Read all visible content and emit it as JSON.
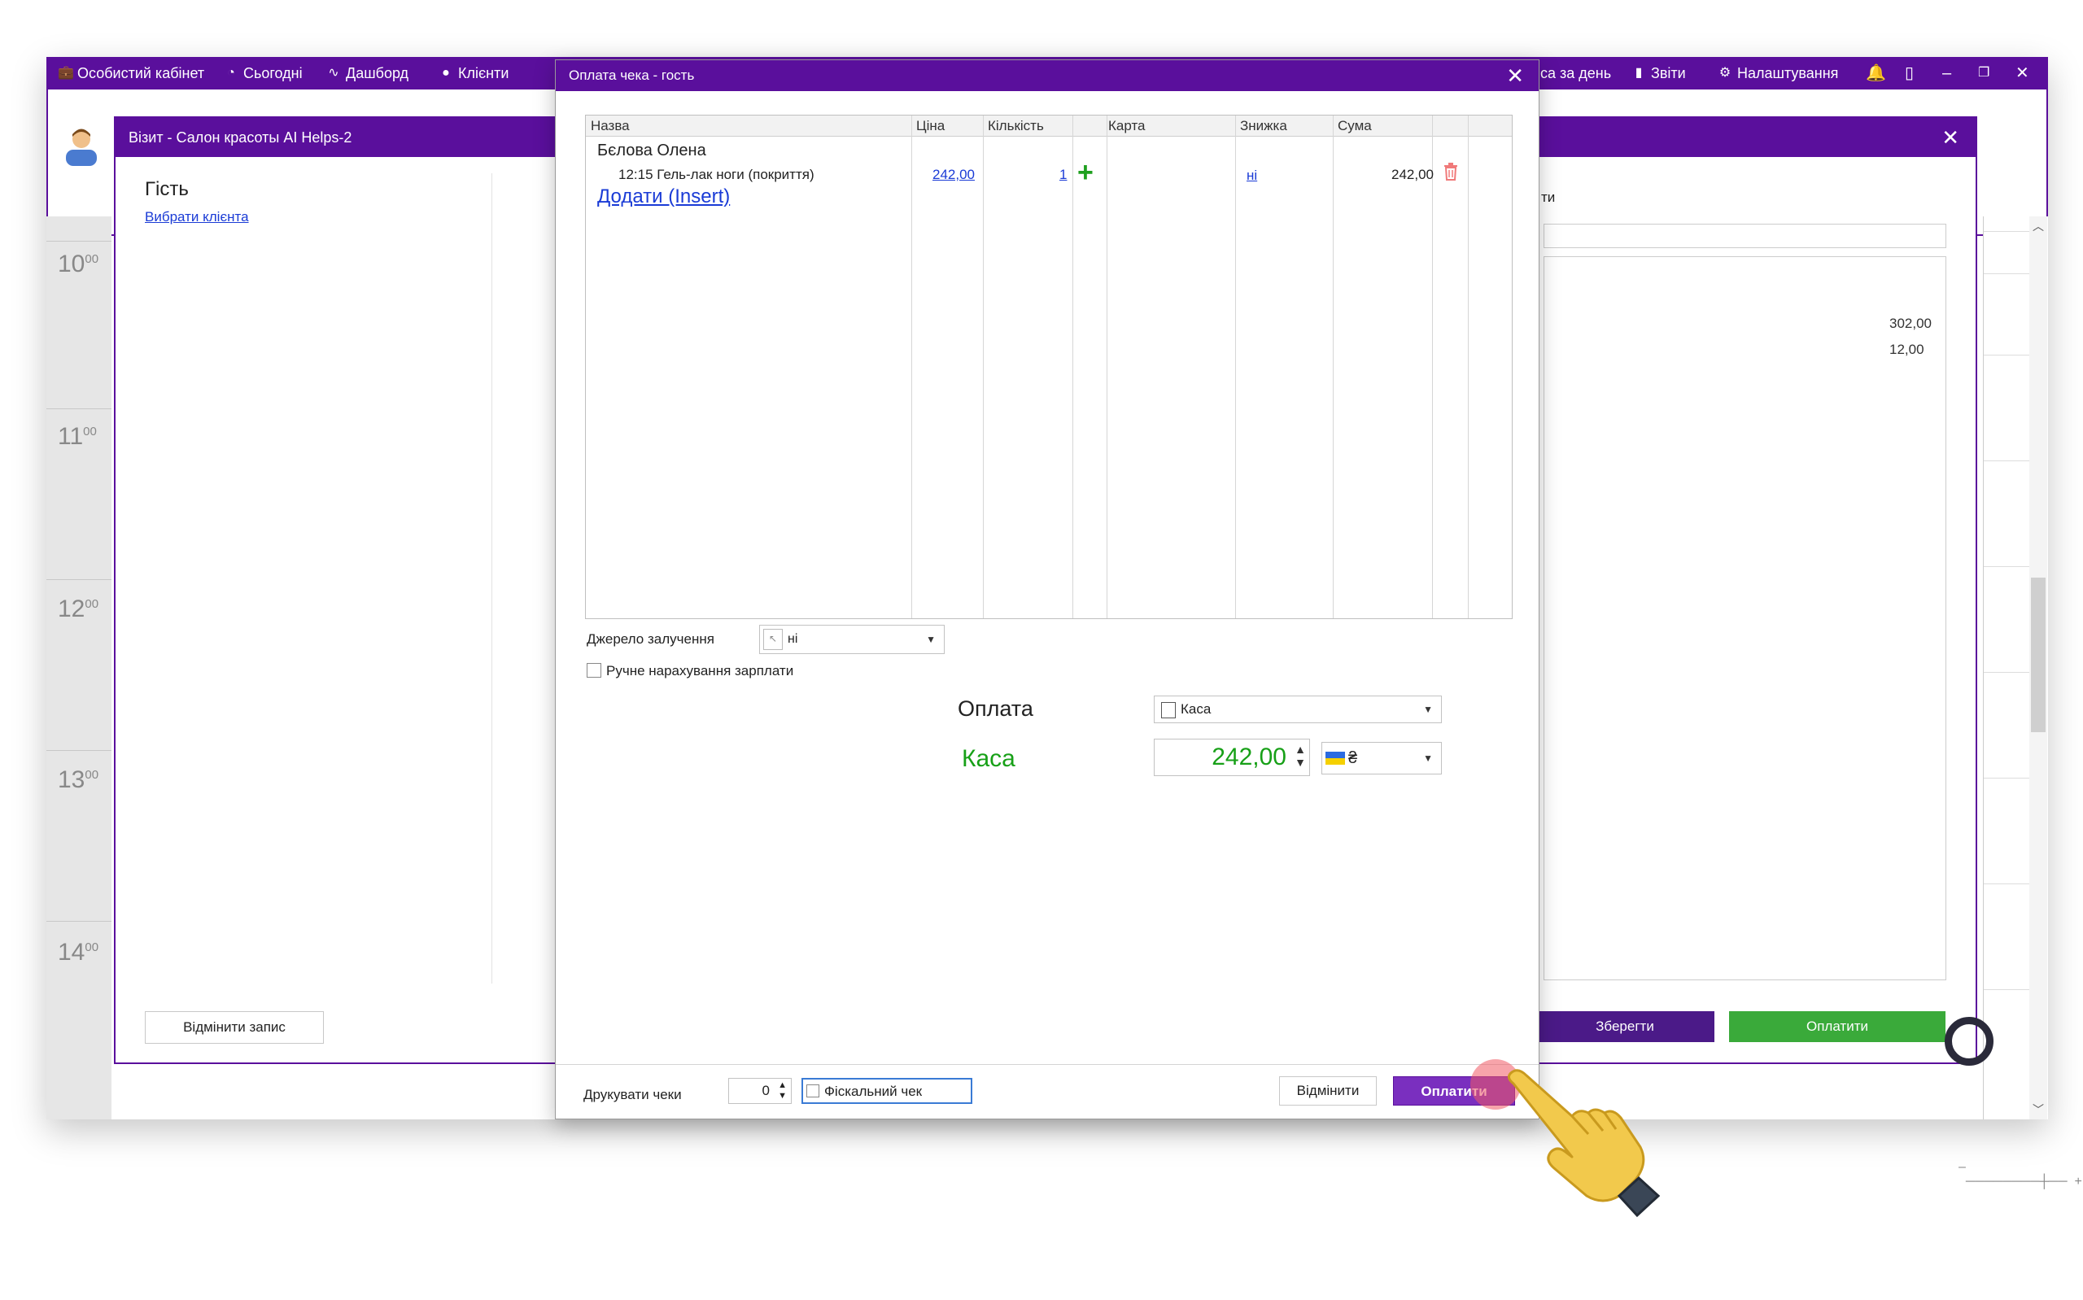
{
  "app": {
    "nav": {
      "cabinet": "Особистий кабінет",
      "today": "Сьогодні",
      "dashboard": "Дашборд",
      "clients": "Клієнти",
      "cash_day": "са за день",
      "reports": "Звіти",
      "settings": "Налаштування"
    },
    "hours": [
      {
        "h": "10",
        "m": "00"
      },
      {
        "h": "11",
        "m": "00"
      },
      {
        "h": "12",
        "m": "00"
      },
      {
        "h": "13",
        "m": "00"
      },
      {
        "h": "14",
        "m": "00"
      }
    ]
  },
  "visit": {
    "title": "Візит - Салон красоты AI Helps-2",
    "guest": "Гість",
    "choose_client": "Вибрати клієнта",
    "cancel_record": "Відмінити запис",
    "save": "Зберегти",
    "pay": "Оплатити",
    "right_label": "ти",
    "values": [
      "302,00",
      "12,00"
    ]
  },
  "dialog": {
    "title": "Оплата чека - гость",
    "columns": [
      "Назва",
      "Ціна",
      "Кількість",
      "Карта",
      "Знижка",
      "Сума"
    ],
    "client": "Бєлова Олена",
    "item": {
      "name": "12:15 Гель-лак ноги (покриття)",
      "price": "242,00",
      "qty": "1",
      "discount": "ні",
      "sum": "242,00"
    },
    "add_insert": "Додати (Insert)",
    "source_label": "Джерело залучення",
    "source_value": "ні",
    "manual_salary": "Ручне нарахування зарплати",
    "payment_label": "Оплата",
    "payment_method": "Каса",
    "kasa_label": "Каса",
    "amount": "242,00",
    "currency": "₴",
    "print_label": "Друкувати чеки",
    "print_count": "0",
    "fiscal": "Фіскальний чек",
    "cancel": "Відмінити",
    "pay": "Оплатити"
  },
  "colors": {
    "brand_purple": "#5a0f9c",
    "pay_button": "#7a2fbf",
    "green": "#17a017",
    "save_button": "#4b1a88",
    "pay_green": "#3aaa3a"
  }
}
